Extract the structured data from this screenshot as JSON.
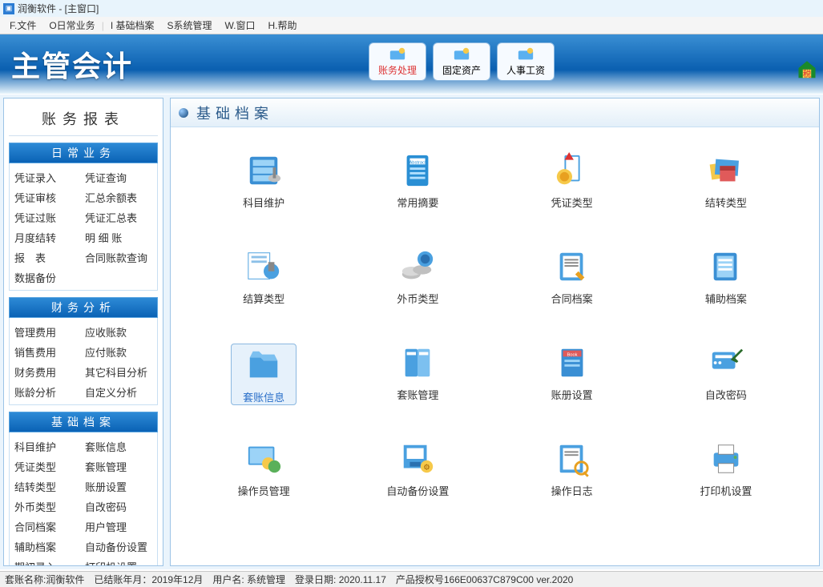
{
  "title": "润衡软件 - [主窗口]",
  "menu": [
    "F.文件",
    "O日常业务",
    "I 基础档案",
    "S系统管理",
    "W.窗口",
    "H.帮助"
  ],
  "logo": "主管会计",
  "topbtns": [
    {
      "label": "账务处理",
      "color": "red"
    },
    {
      "label": "固定资产",
      "color": ""
    },
    {
      "label": "人事工资",
      "color": ""
    }
  ],
  "sidebar": {
    "title": "账务报表",
    "sections": [
      {
        "head": "日常业务",
        "rows": [
          [
            "凭证录入",
            "凭证查询"
          ],
          [
            "凭证审核",
            "汇总余额表"
          ],
          [
            "凭证过账",
            "凭证汇总表"
          ],
          [
            "月度结转",
            "明 细 账"
          ],
          [
            "报　表",
            "合同账款查询"
          ],
          [
            "数据备份",
            ""
          ]
        ]
      },
      {
        "head": "财务分析",
        "rows": [
          [
            "管理费用",
            "应收账款"
          ],
          [
            "销售费用",
            "应付账款"
          ],
          [
            "财务费用",
            "其它科目分析"
          ],
          [
            "账龄分析",
            "自定义分析"
          ]
        ]
      },
      {
        "head": "基础档案",
        "rows": [
          [
            "科目维护",
            "套账信息"
          ],
          [
            "凭证类型",
            "套账管理"
          ],
          [
            "结转类型",
            "账册设置"
          ],
          [
            "外币类型",
            "自改密码"
          ],
          [
            "合同档案",
            "用户管理"
          ],
          [
            "辅助档案",
            "自动备份设置"
          ],
          [
            "期初录入",
            "打印机设置"
          ]
        ]
      }
    ]
  },
  "main": {
    "title": "基础档案",
    "items": [
      {
        "label": "科目维护",
        "icon": "cabinet"
      },
      {
        "label": "常用摘要",
        "icon": "abstract"
      },
      {
        "label": "凭证类型",
        "icon": "medal"
      },
      {
        "label": "结转类型",
        "icon": "stack"
      },
      {
        "label": "结算类型",
        "icon": "stamp"
      },
      {
        "label": "外币类型",
        "icon": "coins"
      },
      {
        "label": "合同档案",
        "icon": "contract"
      },
      {
        "label": "辅助档案",
        "icon": "auxfile"
      },
      {
        "label": "套账信息",
        "icon": "folder",
        "selected": true
      },
      {
        "label": "套账管理",
        "icon": "ledger"
      },
      {
        "label": "账册设置",
        "icon": "book"
      },
      {
        "label": "自改密码",
        "icon": "keycard"
      },
      {
        "label": "操作员管理",
        "icon": "users"
      },
      {
        "label": "自动备份设置",
        "icon": "backup"
      },
      {
        "label": "操作日志",
        "icon": "log"
      },
      {
        "label": "打印机设置",
        "icon": "printer"
      }
    ]
  },
  "status": "套账名称:润衡软件　已结账年月：2019年12月　用户名: 系统管理　登录日期: 2020.11.17　产品授权号166E00637C879C00  ver.2020"
}
